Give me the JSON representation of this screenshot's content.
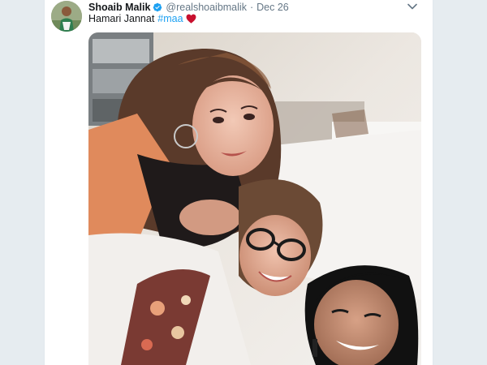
{
  "tweet": {
    "author_name": "Shoaib Malik",
    "handle": "@realshoaibmalik",
    "separator": "·",
    "date": "Dec 26",
    "text": "Hamari Jannat",
    "hashtag": "#maa",
    "verified": true
  },
  "icons": {
    "verified": "verified-badge-icon",
    "heart": "red-heart-emoji",
    "caret": "chevron-down-icon"
  },
  "colors": {
    "link": "#1da1f2",
    "heart": "#c8102e",
    "secondary_text": "#657786",
    "page_background": "#e6ecf0"
  }
}
